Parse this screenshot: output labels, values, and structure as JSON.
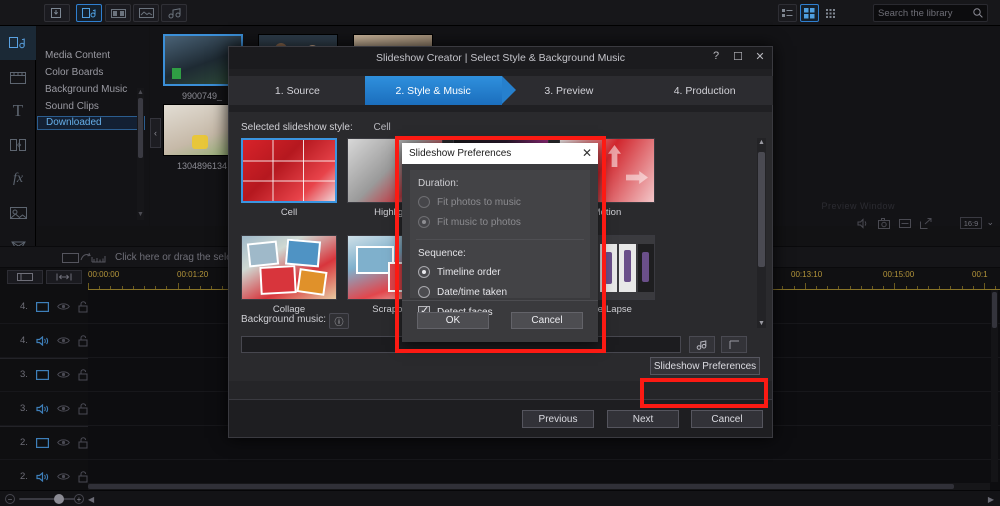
{
  "topbar": {
    "import_icon": "import-media-icon",
    "tabs": [
      {
        "name": "media-room",
        "icon": "media-room-icon",
        "selected": true
      },
      {
        "name": "title-room",
        "icon": "title-room-icon",
        "selected": false
      },
      {
        "name": "transition-room",
        "icon": "transition-room-icon",
        "selected": false
      },
      {
        "name": "audio-room",
        "icon": "audio-room-icon",
        "selected": false
      }
    ],
    "view_list": "list-view-icon",
    "view_grid": "grid-view-icon",
    "view_tile": "tile-view-icon",
    "search": {
      "placeholder": "Search the library",
      "value": "",
      "icon": "search-icon"
    }
  },
  "rail": {
    "items": [
      {
        "name": "media-room",
        "icon": "media-room-icon",
        "active": true
      },
      {
        "name": "room-library",
        "icon": "library-icon",
        "active": false
      },
      {
        "name": "title-room",
        "icon": "T",
        "active": false
      },
      {
        "name": "transition-room",
        "icon": "transition-icon",
        "active": false
      },
      {
        "name": "effect-room",
        "icon": "fx",
        "active": false
      },
      {
        "name": "overlay-room",
        "icon": "overlay-icon",
        "active": false
      },
      {
        "name": "particle-room",
        "icon": "particle-icon",
        "active": false
      },
      {
        "name": "subtitle-room",
        "icon": "subtitle-icon",
        "active": false
      },
      {
        "name": "more-rooms",
        "icon": "ellipsis-icon",
        "active": false
      }
    ]
  },
  "library_nav": {
    "items": [
      {
        "label": "Media Content",
        "selected": false
      },
      {
        "label": "Color Boards",
        "selected": false
      },
      {
        "label": "Background Music",
        "selected": false
      },
      {
        "label": "Sound Clips",
        "selected": false
      },
      {
        "label": "Downloaded",
        "selected": true
      }
    ]
  },
  "media_items": [
    {
      "label": "9900749_",
      "selected": true,
      "style": "vid1"
    },
    {
      "label": "",
      "selected": false,
      "style": "vid2"
    },
    {
      "label": "",
      "selected": false,
      "style": "vid3"
    },
    {
      "label": "",
      "selected": false,
      "style": "vid4"
    },
    {
      "label": "1304896134",
      "selected": false,
      "style": "vid5"
    }
  ],
  "player": {
    "title": "Preview Window",
    "ratio": "16:9",
    "icons": [
      "volume-icon",
      "snapshot-icon",
      "notes-icon",
      "fullscreen-icon"
    ]
  },
  "dropbar": {
    "icon": "drag-to-timeline-icon",
    "text": "Click here or drag the selected"
  },
  "timeline": {
    "tool_buttons": [
      {
        "name": "track-manager",
        "icon": "track-manager-icon"
      },
      {
        "name": "magnet-snap",
        "icon": "magnet-icon"
      }
    ],
    "ruler_labels": [
      "00:00:00",
      "00:01:20",
      "00:13:10",
      "00:15:00",
      "00:1"
    ],
    "tracks": [
      {
        "num": "4.",
        "type": "video"
      },
      {
        "num": "4.",
        "type": "audio"
      },
      {
        "num": "3.",
        "type": "video"
      },
      {
        "num": "3.",
        "type": "audio"
      },
      {
        "num": "2.",
        "type": "video"
      },
      {
        "num": "2.",
        "type": "audio"
      }
    ],
    "zoom_minus": "−",
    "zoom_plus": "+"
  },
  "modal": {
    "title": "Slideshow Creator | Select Style & Background Music",
    "help_label": "?",
    "maximize_label": "☐",
    "close_label": "✕",
    "steps": [
      {
        "label": "1. Source",
        "active": false
      },
      {
        "label": "2. Style & Music",
        "active": true
      },
      {
        "label": "3. Preview",
        "active": false
      },
      {
        "label": "4. Production",
        "active": false
      }
    ],
    "selected_style_label": "Selected slideshow style:",
    "selected_style_value": "Cell",
    "styles": [
      {
        "label": "Cell",
        "selected": true,
        "swatch": "hl-flower"
      },
      {
        "label": "Highlights",
        "selected": false,
        "swatch": "hl-gray"
      },
      {
        "label": "",
        "selected": false,
        "swatch": "hl-dark"
      },
      {
        "label": "Motion",
        "selected": false,
        "swatch": "hl-motion"
      },
      {
        "label": "Collage",
        "selected": false,
        "swatch": "hl-collage"
      },
      {
        "label": "Scrapbook",
        "selected": false,
        "swatch": "hl-scrap"
      },
      {
        "label": "",
        "selected": false,
        "swatch": "hl-fruit"
      },
      {
        "label": "Time-Lapse",
        "selected": false,
        "swatch": "hl-time"
      }
    ],
    "background_music_label": "Background music:",
    "info_icon": "info-icon",
    "music_input_value": "",
    "music_browse_icon": "music-note-icon",
    "music_extra_icon": "music-trim-icon",
    "preferences_button": "Slideshow Preferences",
    "footer": {
      "previous": "Previous",
      "next": "Next",
      "cancel": "Cancel"
    }
  },
  "preferences_dialog": {
    "title": "Slideshow Preferences",
    "close_label": "✕",
    "duration_label": "Duration:",
    "duration_options": [
      {
        "label": "Fit photos to music",
        "checked": false,
        "disabled": true
      },
      {
        "label": "Fit music to photos",
        "checked": true,
        "disabled": true
      }
    ],
    "sequence_label": "Sequence:",
    "sequence_options": [
      {
        "label": "Timeline order",
        "checked": true,
        "type": "radio"
      },
      {
        "label": "Date/time taken",
        "checked": false,
        "type": "radio"
      },
      {
        "label": "Detect faces",
        "checked": true,
        "type": "checkbox"
      }
    ],
    "ok_label": "OK",
    "cancel_label": "Cancel"
  },
  "annotations": {
    "accent_color": "#fc1a13",
    "highlight_color": "#3b95e0"
  }
}
